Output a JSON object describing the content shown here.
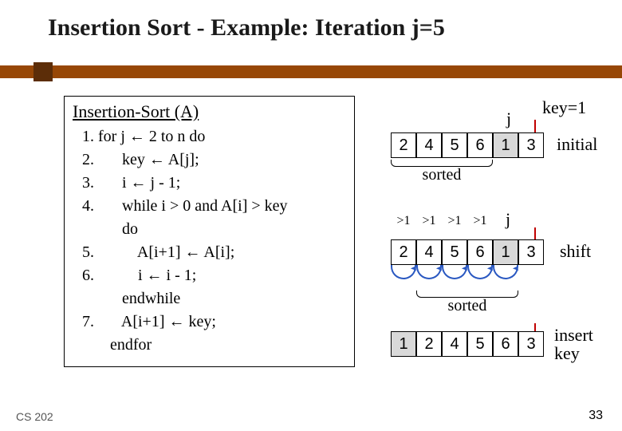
{
  "title": "Insertion Sort - Example: Iteration j=5",
  "algo": {
    "header": "Insertion-Sort (A)",
    "lines": [
      "1. for j ← 2 to n do",
      "2.       key ← A[j];",
      "3.       i ← j - 1;",
      "4.       while i > 0 and A[i] > key",
      "          do",
      "5.           A[i+1] ← A[i];",
      "6.           i ← i - 1;",
      "          endwhile",
      "7.       A[i+1] ← key;",
      "       endfor"
    ]
  },
  "viz": {
    "key_label": "key=1",
    "j_label": "j",
    "sorted_label": "sorted",
    "row_initial": {
      "cells": [
        "2",
        "4",
        "5",
        "6",
        "1",
        "3"
      ],
      "highlight_index": 4,
      "label": "initial"
    },
    "gt_marks": [
      ">1",
      ">1",
      ">1",
      ">1"
    ],
    "row_shift": {
      "cells": [
        "2",
        "4",
        "5",
        "6",
        "1",
        "3"
      ],
      "highlight_index": 4,
      "label": "shift"
    },
    "row_insert": {
      "cells": [
        "1",
        "2",
        "4",
        "5",
        "6",
        "3"
      ],
      "highlight_index": 0,
      "label": "insert\nkey"
    }
  },
  "footer": {
    "left": "CS 202",
    "right": "33"
  }
}
